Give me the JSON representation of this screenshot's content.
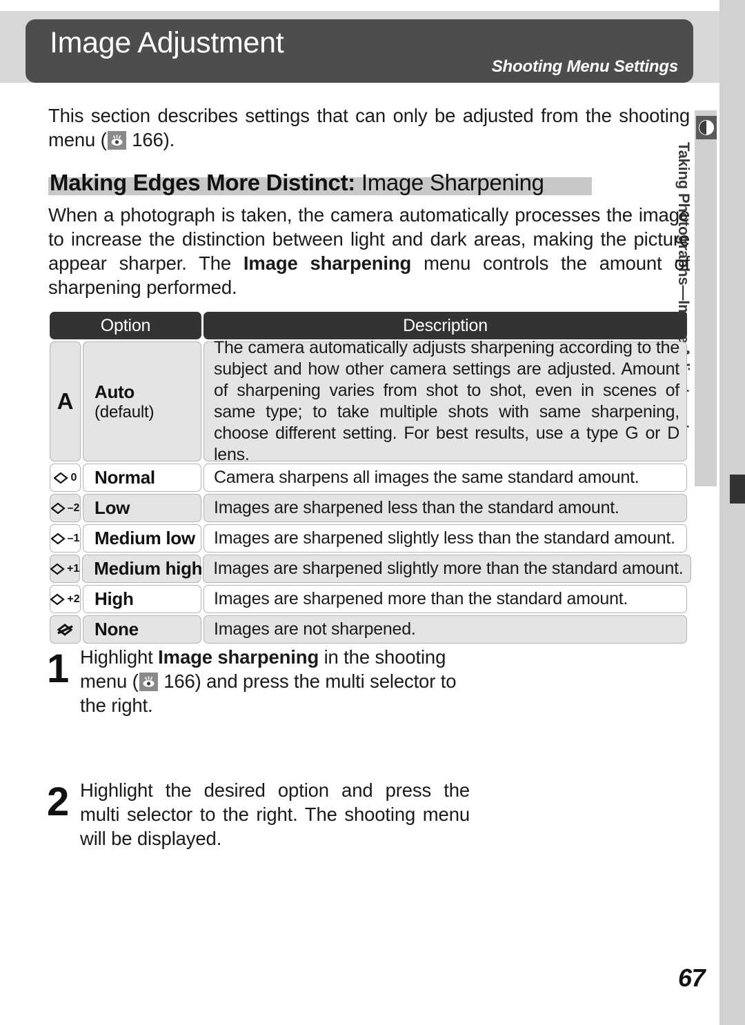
{
  "header": {
    "title": "Image Adjustment",
    "subtitle": "Shooting Menu Settings"
  },
  "sidetab": {
    "label": "Taking Photographs—Image Adjustment",
    "icon": "contrast-half-circle-icon"
  },
  "intro": {
    "before_icon": "This section describes settings that can only be adjusted from the shooting menu (",
    "page_ref": "166",
    "after": ").",
    "icon": "page-reference-eye-icon"
  },
  "heading": {
    "bold_part": "Making Edges More Distinct:",
    "regular_part": " Image Sharpening"
  },
  "paragraph": {
    "part1": "When a photograph is taken, the camera automatically processes the image to increase the distinction between light and dark areas, making the picture appear sharper.  The ",
    "bold": "Image sharpening",
    "part2": " menu controls the amount of sharpening performed."
  },
  "table": {
    "headers": {
      "option": "Option",
      "description": "Description"
    },
    "rows": [
      {
        "icon": "A",
        "icon_name": "auto-a-icon",
        "label": "Auto",
        "sublabel": "(default)",
        "description": "The camera automatically adjusts sharpening according to the subject and how other camera settings are adjusted.  Amount of sharpening varies from shot to shot, even in scenes of same type; to take multiple shots with same sharpening, choose different setting.  For best results, use a type G or D lens."
      },
      {
        "icon": "0",
        "icon_name": "sharpening-diamond-0-icon",
        "label": "Normal",
        "description": "Camera sharpens all images the same standard amount."
      },
      {
        "icon": "–2",
        "icon_name": "sharpening-diamond-minus2-icon",
        "label": "Low",
        "description": "Images are sharpened less than the standard amount."
      },
      {
        "icon": "–1",
        "icon_name": "sharpening-diamond-minus1-icon",
        "label": "Medium low",
        "description": "Images are sharpened slightly less than the standard amount."
      },
      {
        "icon": "+1",
        "icon_name": "sharpening-diamond-plus1-icon",
        "label": "Medium high",
        "description": "Images are sharpened slightly more than the standard amount."
      },
      {
        "icon": "+2",
        "icon_name": "sharpening-diamond-plus2-icon",
        "label": "High",
        "description": "Images are sharpened more than the standard amount."
      },
      {
        "icon": "",
        "icon_name": "sharpening-none-crossed-diamond-icon",
        "label": "None",
        "description": "Images are not sharpened."
      }
    ]
  },
  "steps": [
    {
      "number": "1",
      "part1": "Highlight ",
      "bold": "Image sharpening",
      "part2": " in the shooting menu (",
      "page_ref": "166",
      "part3": ") and press the multi selector to the right."
    },
    {
      "number": "2",
      "text": "Highlight the desired option and press the multi selector to the right.  The shooting menu will be displayed."
    }
  ],
  "page_number": "67",
  "colors": {
    "header_bar": "#4d4d4d",
    "table_header": "#333333",
    "row_shade": "#e4e4e4",
    "side_band": "#d2d2d2",
    "heading_band": "#c8c8c8"
  }
}
